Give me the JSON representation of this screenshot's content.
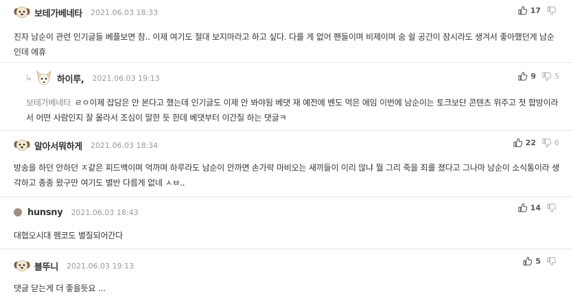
{
  "comments": [
    {
      "nick": "보테가베네타",
      "date": "2021.06.03 18:33",
      "text": "진자 남순이 관련 인기글들 베플보면 참.. 이제 여기도 절대 보지마라고 하고 싶다. 다를 게 없어 팬들이며 비제이며 숨 쉴 공간이 잠시라도 생겨서 좋아했던게 남순인데 에휴",
      "likes": "17",
      "dislikes": "0",
      "avatar_icon": "dog-face-icon"
    },
    {
      "nick": "하이루,",
      "date": "2021.06.03 19:13",
      "reply_to": "보테가베네타",
      "text": "ㄹㅇ이제 잡담은 안 본다고 했는데 인기글도 이제 안 봐야됨 베댓 재 예전에 벤도 먹은 애임 이번에 남순이는 토크보단 콘텐츠 위주고 첫 합방이라서 어떤 사람인지 잘 몰라서 조심이 말한 듯 한데 베댓부터 이간질 하는 댓글ㅋ",
      "likes": "9",
      "dislikes": "5",
      "avatar_icon": "chihuahua-icon"
    },
    {
      "nick": "알아서뭐하게",
      "date": "2021.06.03 18:34",
      "text": "방송을 하던 안하던 ㅈ같은 피드백이며 억까며 하루라도 남순이 안까면 손가락 마비오는 새끼들이 이리 많냐 뭘 그리 죽을 죄를 졌다고 그나마 남순이 소식통이라 생각하고 종종 왔구만 여기도 별반 다름게 없네 ㅅㅂ..",
      "likes": "22",
      "dislikes": "6",
      "avatar_icon": "dog-face-icon"
    },
    {
      "nick": "hunsny",
      "date": "2021.06.03 18:43",
      "text": "대협오시대 펨코도 별질되어간다",
      "likes": "14",
      "dislikes": "0",
      "avatar_icon": "default-avatar-icon"
    },
    {
      "nick": "블뚜니",
      "date": "2021.06.03 19:13",
      "text": "댓글 닫는게 더 좋을듯요 ...",
      "likes": "5",
      "dislikes": "0",
      "avatar_icon": "dog-face-icon"
    }
  ],
  "colors": {
    "nick": "#333333",
    "date": "#999999",
    "divider": "#e6e6e6",
    "like": "#555555",
    "dislike": "#b0b0b0"
  }
}
